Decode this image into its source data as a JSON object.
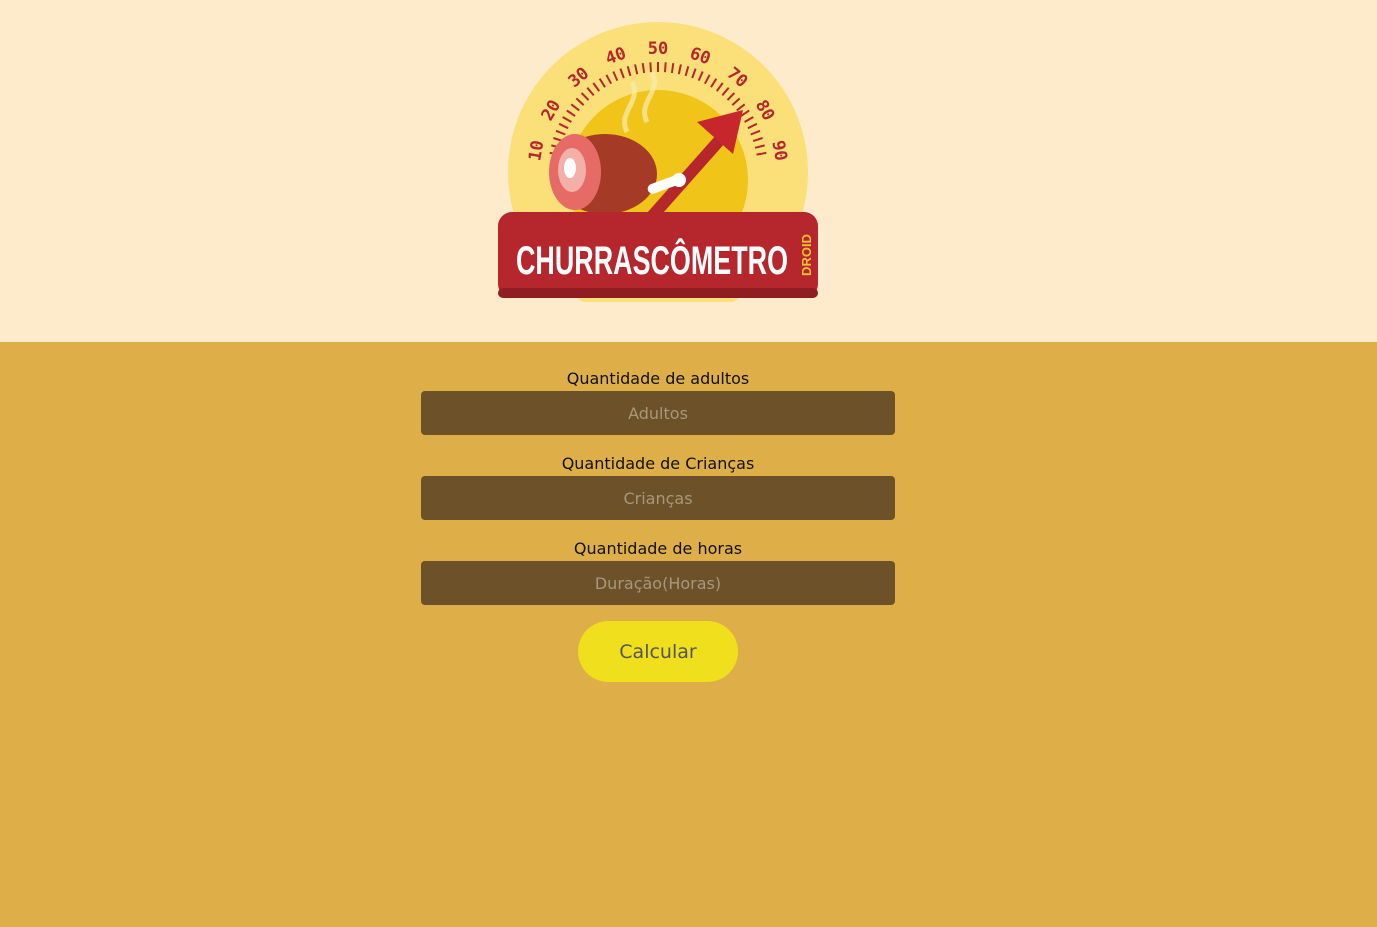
{
  "header": {
    "logo": {
      "title": "CHURRASCÔMETRO",
      "suffix": "DROID",
      "dial_numbers": [
        "10",
        "20",
        "30",
        "40",
        "50",
        "60",
        "70",
        "80",
        "90"
      ]
    }
  },
  "form": {
    "adults": {
      "label": "Quantidade de adultos",
      "placeholder": "Adultos",
      "value": ""
    },
    "children": {
      "label": "Quantidade de Crianças",
      "placeholder": "Crianças",
      "value": ""
    },
    "hours": {
      "label": "Quantidade de horas",
      "placeholder": "Duração(Horas)",
      "value": ""
    },
    "submit_label": "Calcular"
  },
  "colors": {
    "header_bg": "#feebcc",
    "main_bg": "#deaf48",
    "input_bg": "#6d5128",
    "button_bg": "#efdf1c",
    "logo_banner": "#b5272d",
    "logo_dial": "#fbe07a"
  }
}
